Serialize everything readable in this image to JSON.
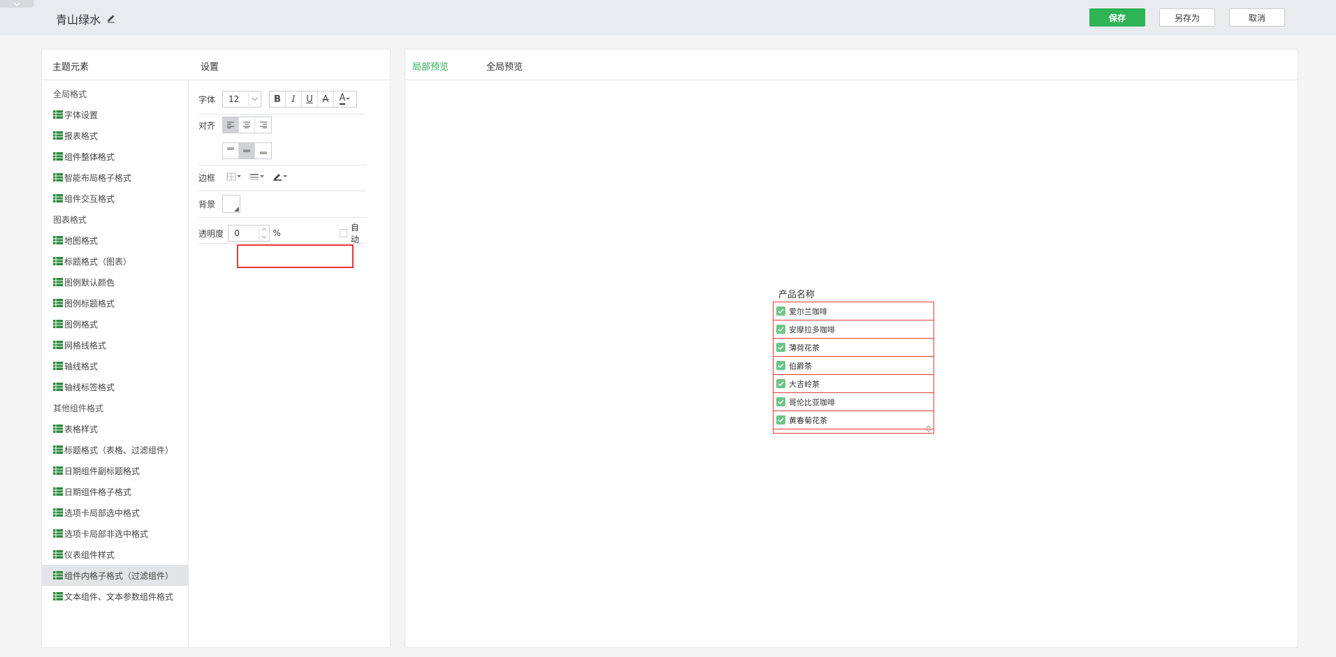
{
  "topbar": {
    "theme_name": "青山绿水",
    "save_label": "保存",
    "saveas_label": "另存为",
    "cancel_label": "取消"
  },
  "left_panel": {
    "header_elements": "主题元素",
    "header_settings": "设置"
  },
  "tree": [
    {
      "type": "group",
      "label": "全局格式"
    },
    {
      "type": "item",
      "label": "字体设置"
    },
    {
      "type": "item",
      "label": "报表格式"
    },
    {
      "type": "item",
      "label": "组件整体格式"
    },
    {
      "type": "item",
      "label": "智能布局格子格式"
    },
    {
      "type": "item",
      "label": "组件交互格式"
    },
    {
      "type": "group",
      "label": "图表格式"
    },
    {
      "type": "item",
      "label": "地图格式"
    },
    {
      "type": "item",
      "label": "标题格式（图表）"
    },
    {
      "type": "item",
      "label": "图例默认颜色"
    },
    {
      "type": "item",
      "label": "图例标题格式"
    },
    {
      "type": "item",
      "label": "图例格式"
    },
    {
      "type": "item",
      "label": "网格线格式"
    },
    {
      "type": "item",
      "label": "轴线格式"
    },
    {
      "type": "item",
      "label": "轴线标签格式"
    },
    {
      "type": "group",
      "label": "其他组件格式"
    },
    {
      "type": "item",
      "label": "表格样式"
    },
    {
      "type": "item",
      "label": "标题格式（表格、过滤组件）"
    },
    {
      "type": "item",
      "label": "日期组件副标题格式"
    },
    {
      "type": "item",
      "label": "日期组件格子格式"
    },
    {
      "type": "item",
      "label": "选项卡局部选中格式"
    },
    {
      "type": "item",
      "label": "选项卡局部非选中格式"
    },
    {
      "type": "item",
      "label": "仪表组件样式"
    },
    {
      "type": "item",
      "label": "组件内格子格式（过滤组件）",
      "selected": true
    },
    {
      "type": "item",
      "label": "文本组件、文本参数组件格式"
    }
  ],
  "settings": {
    "font_label": "字体",
    "font_size": "12",
    "align_label": "对齐",
    "border_label": "边框",
    "background_label": "背景",
    "opacity_label": "透明度",
    "opacity_value": "0",
    "percent": "%",
    "auto_label": "自动"
  },
  "preview": {
    "tab_local": "局部预览",
    "tab_global": "全局预览",
    "filter_title": "产品名称",
    "filter_items": [
      "爱尔兰咖啡",
      "安摩拉多咖啡",
      "薄荷花茶",
      "伯爵茶",
      "大吉岭茶",
      "哥伦比亚咖啡",
      "黄春菊花茶"
    ]
  },
  "colors": {
    "accent": "#2eb356",
    "highlight": "#e53935",
    "tree_icon": "#2e8b3d"
  }
}
